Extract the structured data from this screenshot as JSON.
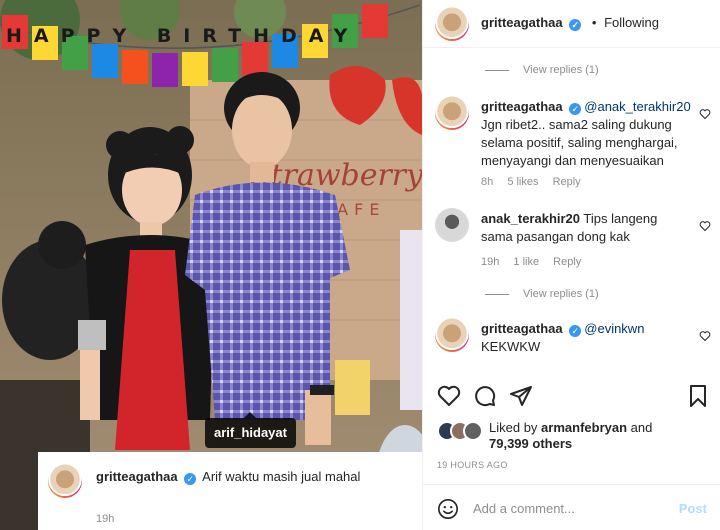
{
  "photo": {
    "banner_text": "HAPPY BIRTHDAY",
    "wall_sign": "Strawberry",
    "wall_sign_sub": "CAFE",
    "tag_username": "arif_hidayat"
  },
  "caption": {
    "username": "gritteagathaa",
    "text": "Arif waktu masih jual mahal",
    "time": "19h"
  },
  "header": {
    "username": "gritteagathaa",
    "separator": "•",
    "follow_label": "Following"
  },
  "comments": [
    {
      "view_replies": "View replies (1)"
    },
    {
      "username": "gritteagathaa",
      "mention": "@anak_terakhir20",
      "text": "Jgn ribet2.. sama2 saling dukung selama positif, saling menghargai, menyayangi dan menyesuaikan",
      "time": "8h",
      "likes": "5 likes",
      "reply": "Reply"
    },
    {
      "username": "anak_terakhir20",
      "text": "Tips langeng sama pasangan dong kak",
      "time": "19h",
      "likes": "1 like",
      "reply": "Reply"
    },
    {
      "view_replies": "View replies (1)"
    },
    {
      "username": "gritteagathaa",
      "mention": "@evinkwn",
      "text": "KEKWKW"
    }
  ],
  "likes": {
    "prefix": "Liked by",
    "user": "armanfebryan",
    "conjunction": "and",
    "others": "79,399 others"
  },
  "post_time": "19 HOURS AGO",
  "add_comment": {
    "placeholder": "Add a comment...",
    "post_label": "Post"
  },
  "colors": {
    "accent": "#3897f0",
    "mention": "#00376b",
    "muted": "#8e8e8e",
    "post_disabled": "#b2dffc"
  }
}
